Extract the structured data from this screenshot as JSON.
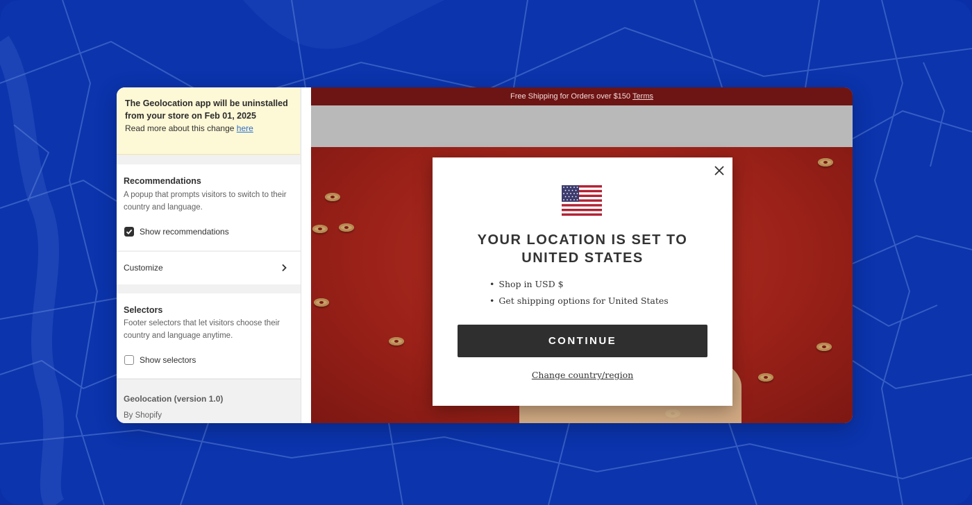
{
  "colors": {
    "background": "#0b34ad",
    "banner_bg": "#fdf8d6",
    "announce_bg": "#6d1414",
    "hero_red": "#a2251d",
    "button_dark": "#2f2f2f",
    "link_blue": "#2c6ecb"
  },
  "banner": {
    "title": "The Geolocation app will be uninstalled from your store on Feb 01, 2025",
    "text": "Read more about this change",
    "link": "here"
  },
  "recommendations": {
    "title": "Recommendations",
    "description": "A popup that prompts visitors to switch to their country and language.",
    "checkbox_label": "Show recommendations",
    "checked": true
  },
  "customize": {
    "label": "Customize",
    "icon": "chevron-right-icon"
  },
  "selectors": {
    "title": "Selectors",
    "description": "Footer selectors that let visitors choose their country and language anytime.",
    "checkbox_label": "Show selectors",
    "checked": false
  },
  "app_footer": {
    "title": "Geolocation (version 1.0)",
    "by": "By Shopify"
  },
  "store": {
    "announcement": "Free Shipping for Orders over $150",
    "terms": "Terms"
  },
  "modal": {
    "flag_icon": "us-flag-icon",
    "close_icon": "close-icon",
    "title": "YOUR LOCATION IS SET TO UNITED STATES",
    "bullets": [
      "Shop in USD $",
      "Get shipping options for United States"
    ],
    "continue_label": "CONTINUE",
    "change_label": "Change country/region"
  }
}
